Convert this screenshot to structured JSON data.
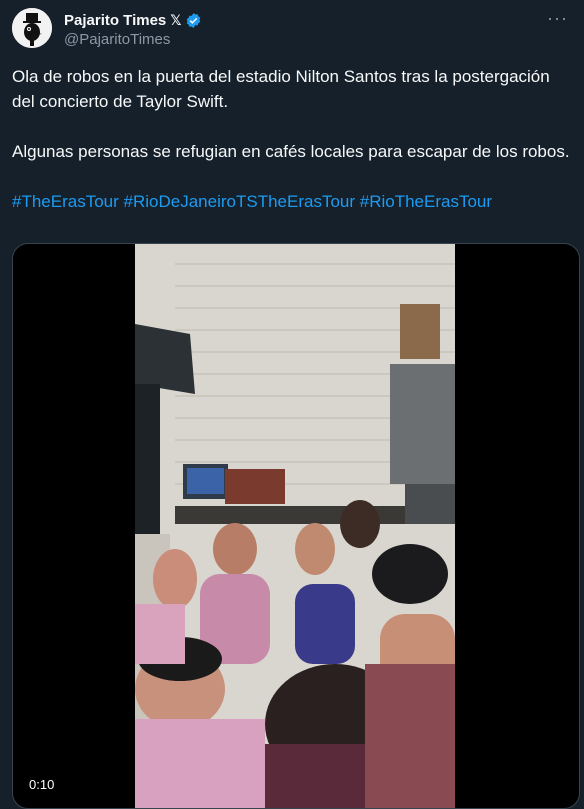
{
  "author": {
    "display_name": "Pajarito Times",
    "x_badge": "𝕏",
    "handle": "@PajaritoTimes",
    "verified": true,
    "verified_color": "#1d9bf0"
  },
  "more_label": "···",
  "tweet": {
    "paragraph1": "Ola de robos en la puerta del estadio Nilton Santos tras la postergación del concierto de Taylor Swift.",
    "paragraph2": "Algunas personas se refugian en cafés locales para escapar de los robos.",
    "hashtags": [
      "#TheErasTour",
      "#RioDeJaneiroTSTheErasTour",
      "#RioTheErasTour"
    ]
  },
  "media": {
    "type": "video",
    "duration": "0:10"
  },
  "colors": {
    "background": "#15202b",
    "text": "#f7f9f9",
    "secondary": "#8b98a5",
    "link": "#1d9bf0",
    "border": "#38444d"
  }
}
